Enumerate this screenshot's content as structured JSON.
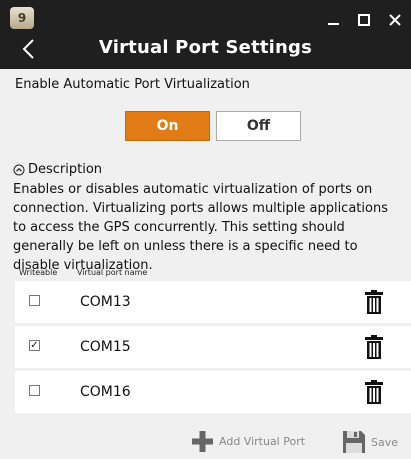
{
  "window": {
    "app_icon_text": "9",
    "title": "Virtual Port Settings",
    "icons": {
      "app": "app-icon",
      "back": "back-arrow-icon",
      "minimize": "minimize-icon",
      "maximize": "maximize-icon",
      "close": "close-icon"
    }
  },
  "auto_virtualization": {
    "label": "Enable Automatic Port Virtualization",
    "on_label": "On",
    "off_label": "Off",
    "selected": "On",
    "accent_color": "#e07b16"
  },
  "description": {
    "heading": "Description",
    "text": "Enables or disables automatic virtualization of ports on connection. Virtualizing ports allows multiple applications to access the GPS concurrently. This setting should generally be left on unless there is a specific need to disable virtualization."
  },
  "ports_table": {
    "columns": [
      "Writeable",
      "Virtual port name"
    ],
    "rows": [
      {
        "name": "COM13",
        "writeable": false,
        "checkbox_glyph": ""
      },
      {
        "name": "COM15",
        "writeable": true,
        "checkbox_glyph": "✓"
      },
      {
        "name": "COM16",
        "writeable": false,
        "checkbox_glyph": ""
      }
    ]
  },
  "footer": {
    "add_label": "Add Virtual Port",
    "save_label": "Save",
    "icons": {
      "add": "plus-icon",
      "save": "save-icon"
    }
  }
}
